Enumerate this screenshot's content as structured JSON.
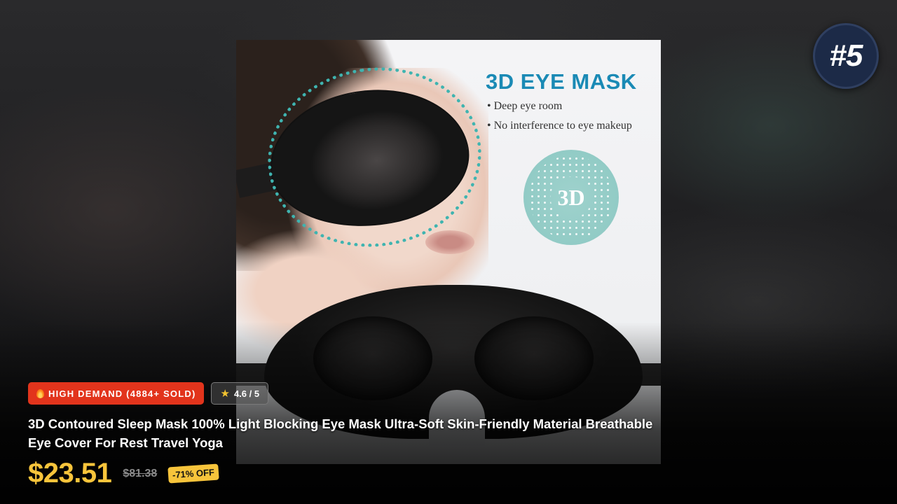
{
  "rank": "#5",
  "image": {
    "heading": "3D EYE MASK",
    "bullets": [
      "Deep eye room",
      "No interference to eye makeup"
    ],
    "badge": "3D"
  },
  "demand_badge": "HIGH DEMAND (4884+ SOLD)",
  "rating": "4.6 / 5",
  "product_title": "3D Contoured Sleep Mask 100% Light Blocking Eye Mask Ultra-Soft Skin-Friendly Material Breathable Eye Cover For Rest Travel Yoga",
  "price": "$23.51",
  "old_price": "$81.38",
  "discount": "-71% OFF",
  "icons": {
    "demand": "flame-icon",
    "rating": "star-icon"
  },
  "colors": {
    "accent_price": "#f7c43b",
    "demand": "#e2341c",
    "rank_bg": "#1c2a47",
    "image_heading": "#1a8ab5"
  }
}
